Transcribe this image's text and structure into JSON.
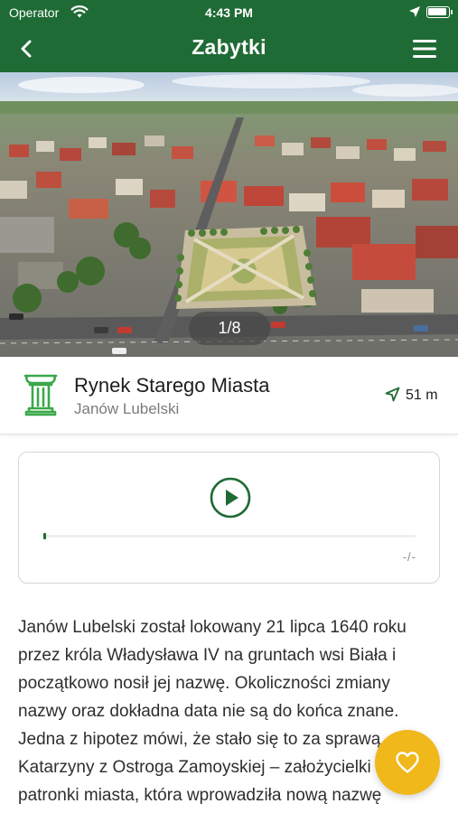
{
  "status_bar": {
    "carrier": "Operator",
    "time": "4:43 PM"
  },
  "nav": {
    "title": "Zabytki",
    "back_icon": "chevron-left-icon",
    "menu_icon": "hamburger-menu-icon"
  },
  "gallery": {
    "counter": "1/8",
    "current": 1,
    "total": 8
  },
  "place": {
    "name": "Rynek Starego Miasta",
    "city": "Janów Lubelski",
    "distance": "51 m",
    "category_icon": "monument-column-icon"
  },
  "audio_player": {
    "time": "-/-",
    "progress": 0.0
  },
  "description": "Janów Lubelski został lokowany 21 lipca 1640 roku przez króla Władysława IV na gruntach wsi Biała i początkowo nosił jej nazwę. Okoliczności zmiany nazwy oraz dokładna data nie są do końca znane. Jedna z hipotez mówi, że stało się to za sprawą Katarzyny z Ostroga Zamoyskiej – założycielki i patronki miasta, która wprowadziła nową nazwę",
  "colors": {
    "brand_green": "#1f6b35",
    "favorite_yellow": "#f1b81b",
    "monument_icon_green": "#3aa84a"
  }
}
